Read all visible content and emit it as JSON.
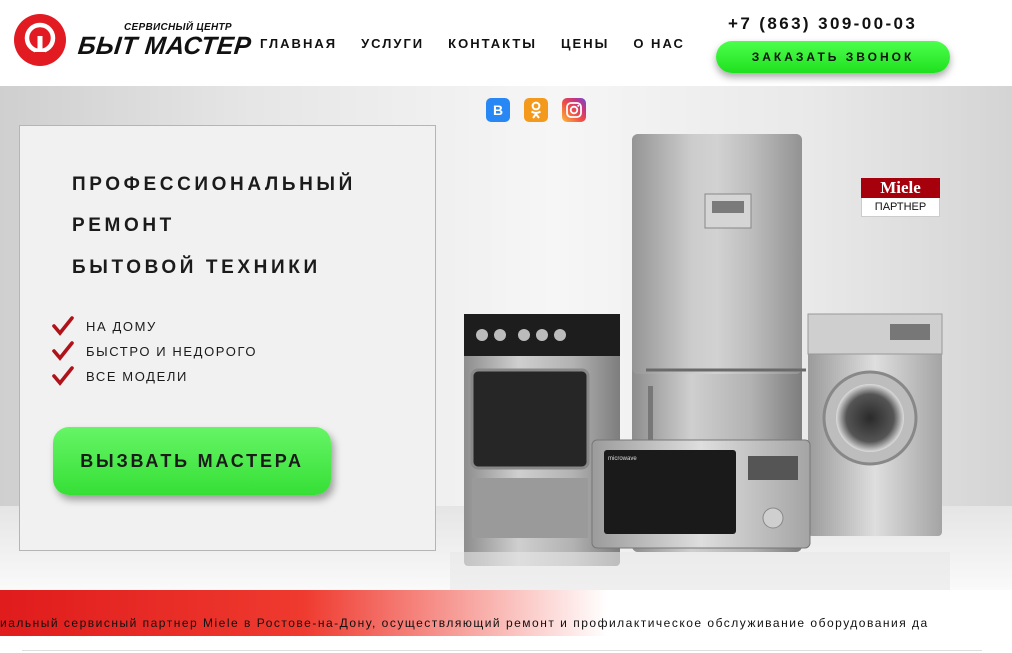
{
  "brand": {
    "subtitle": "СЕРВИСНЫЙ ЦЕНТР",
    "name": "БЫТ МАСТЕР",
    "accent_color": "#e21b22"
  },
  "nav": {
    "items": [
      "ГЛАВНАЯ",
      "УСЛУГИ",
      "КОНТАКТЫ",
      "ЦЕНЫ",
      "О НАС"
    ]
  },
  "contact": {
    "phone": "+7 (863) 309-00-03",
    "callback_label": "ЗАКАЗАТЬ ЗВОНОК",
    "button_color": "#2ee82e"
  },
  "socials": [
    {
      "icon": "vk-icon",
      "glyph": "В"
    },
    {
      "icon": "odnoklassniki-icon",
      "glyph": "ок"
    },
    {
      "icon": "instagram-icon",
      "glyph": "◎"
    }
  ],
  "hero": {
    "title_lines": [
      "ПРОФЕССИОНАЛЬНЫЙ",
      "РЕМОНТ",
      "БЫТОВОЙ ТЕХНИКИ"
    ],
    "features": [
      "НА ДОМУ",
      "БЫСТРО И НЕДОРОГО",
      "ВСЕ МОДЕЛИ"
    ],
    "cta_label": "ВЫЗВАТЬ МАСТЕРА",
    "microwave_label": "microwave"
  },
  "partner_badge": {
    "brand": "Miele",
    "label": "ПАРТНЕР",
    "color": "#a5000c"
  },
  "ticker": {
    "text": "иальный сервисный партнер Miele в Ростове-на-Дону, осуществляющий ремонт и профилактическое обслуживание оборудования да"
  }
}
